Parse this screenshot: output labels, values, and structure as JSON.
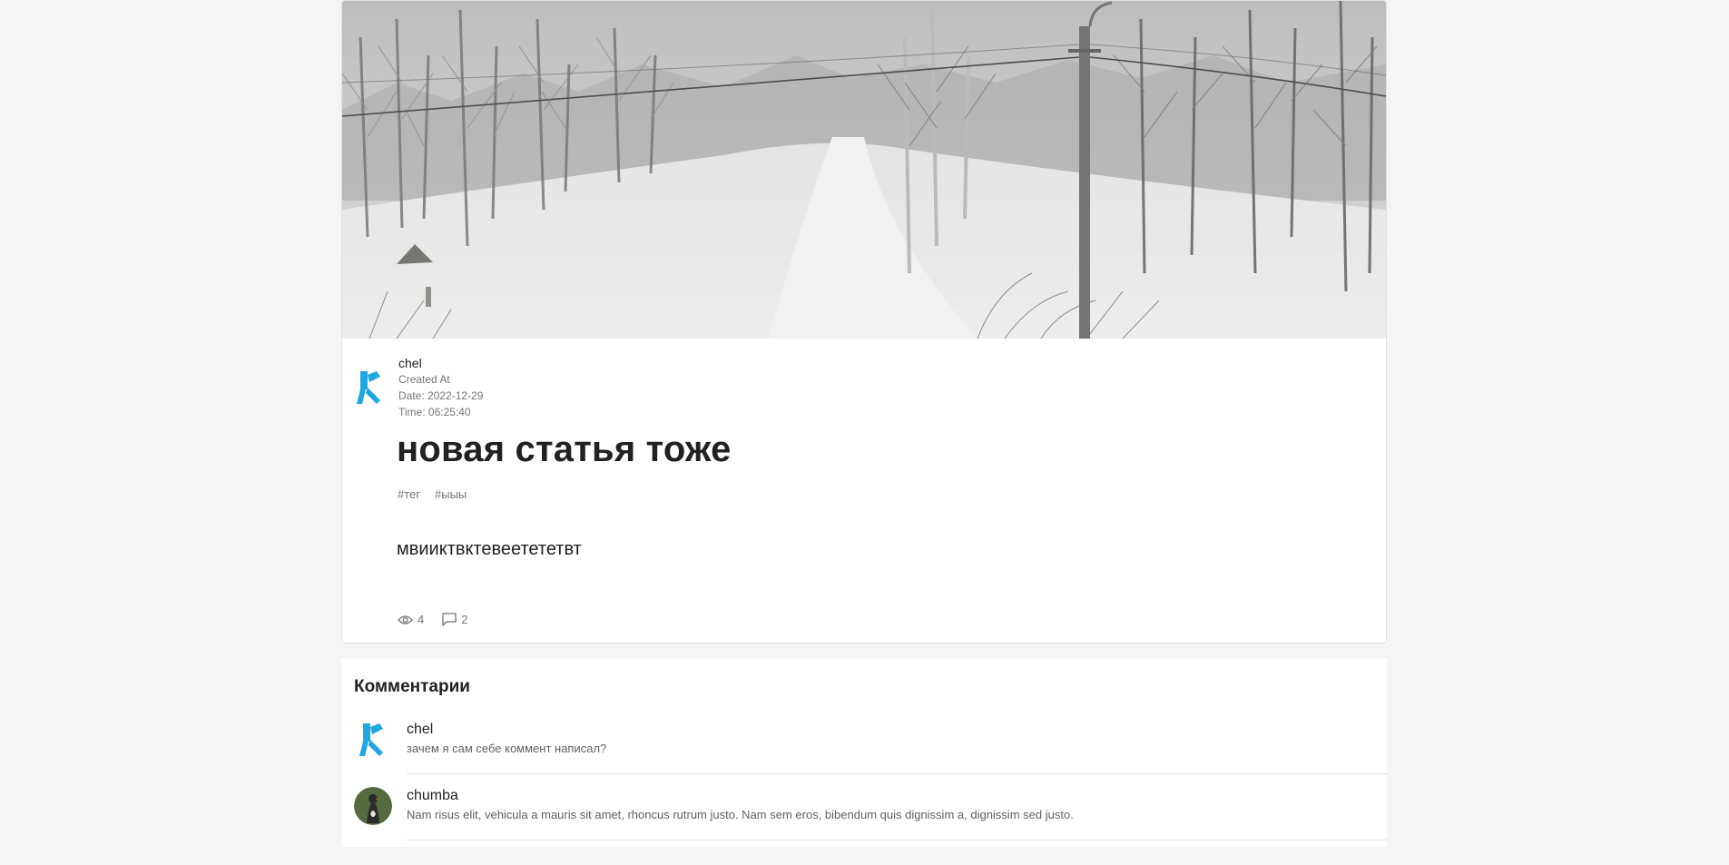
{
  "post": {
    "author": "chel",
    "created_label": "Created At",
    "date_line": "Date: 2022-12-29",
    "time_line": "Time: 06:25:40",
    "title": "новая статья тоже",
    "tags": [
      "#тег",
      "#ыыы"
    ],
    "body": "мвииктвктевеетететвт",
    "views": "4",
    "comments_count": "2"
  },
  "comments": {
    "title": "Комментарии",
    "items": [
      {
        "author": "chel",
        "text": "зачем я сам себе коммент написал?"
      },
      {
        "author": "chumba",
        "text": "Nam risus elit, vehicula a mauris sit amet, rhoncus rutrum justo. Nam sem eros, bibendum quis dignissim a, dignissim sed justo."
      }
    ]
  },
  "colors": {
    "accent": "#1ea7e1",
    "muted": "#757575",
    "text": "#212121",
    "page_bg": "#f5f5f5"
  },
  "icons": {
    "views": "eye-icon",
    "comments": "comment-icon"
  }
}
